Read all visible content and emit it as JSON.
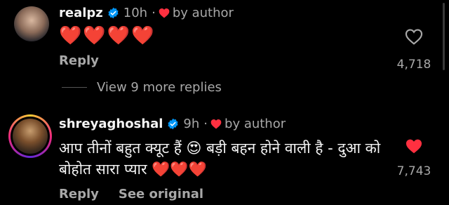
{
  "comments": [
    {
      "username": "realpz",
      "time": "10h",
      "separator": "·",
      "by_author": "by author",
      "text": "❤️❤️❤️❤️",
      "reply_label": "Reply",
      "likes": "4,718",
      "liked": false
    },
    {
      "username": "shreyaghoshal",
      "time": "9h",
      "separator": "·",
      "by_author": "by author",
      "text": "आप तीनों बहुत क्यूट हैं 😍 बड़ी बहन होने वाली है - दुआ को बोहोत सारा प्यार ❤️❤️❤️",
      "reply_label": "Reply",
      "see_original_label": "See original",
      "likes": "7,743",
      "liked": true
    }
  ],
  "view_more_replies": "View 9 more replies",
  "colors": {
    "background": "#000000",
    "text": "#f5f5f5",
    "muted": "#a8a8a8",
    "verified": "#0095f6",
    "heart": "#ff3040"
  }
}
